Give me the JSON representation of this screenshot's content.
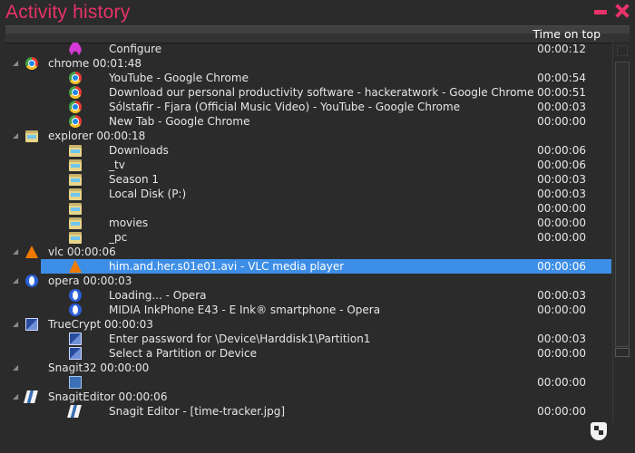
{
  "window": {
    "title": "Activity history"
  },
  "header": {
    "column_label": "Time on top"
  },
  "rows": [
    {
      "kind": "child",
      "icon": "configure",
      "label": "Configure",
      "time": "00:00:12"
    },
    {
      "kind": "group",
      "icon": "chrome",
      "label": "chrome   00:01:48"
    },
    {
      "kind": "child",
      "icon": "chrome",
      "label": "YouTube - Google Chrome",
      "time": "00:00:54"
    },
    {
      "kind": "child",
      "icon": "chrome",
      "label": "Download our personal productivity software - hackeratwork - Google Chrome",
      "time": "00:00:51"
    },
    {
      "kind": "child",
      "icon": "chrome",
      "label": "Sólstafir - Fjara (Official Music Video) - YouTube - Google Chrome",
      "time": "00:00:03"
    },
    {
      "kind": "child",
      "icon": "chrome",
      "label": "New Tab - Google Chrome",
      "time": "00:00:00"
    },
    {
      "kind": "group",
      "icon": "folder",
      "label": "explorer   00:00:18"
    },
    {
      "kind": "child",
      "icon": "folder",
      "label": "Downloads",
      "time": "00:00:06"
    },
    {
      "kind": "child",
      "icon": "folder",
      "label": "_tv",
      "time": "00:00:06"
    },
    {
      "kind": "child",
      "icon": "folder",
      "label": "Season 1",
      "time": "00:00:03"
    },
    {
      "kind": "child",
      "icon": "folder",
      "label": "Local Disk (P:)",
      "time": "00:00:03"
    },
    {
      "kind": "child",
      "icon": "folder",
      "label": "",
      "time": "00:00:00"
    },
    {
      "kind": "child",
      "icon": "folder",
      "label": "movies",
      "time": "00:00:00"
    },
    {
      "kind": "child",
      "icon": "folder",
      "label": "_pc",
      "time": "00:00:00"
    },
    {
      "kind": "group",
      "icon": "vlc",
      "label": "vlc   00:00:06"
    },
    {
      "kind": "child",
      "icon": "vlc",
      "label": "him.and.her.s01e01.avi - VLC media player",
      "time": "00:00:06",
      "selected": true
    },
    {
      "kind": "group",
      "icon": "opera",
      "label": "opera   00:00:03"
    },
    {
      "kind": "child",
      "icon": "opera",
      "label": "Loading... - Opera",
      "time": "00:00:03"
    },
    {
      "kind": "child",
      "icon": "opera",
      "label": "MIDIA InkPhone E43 - E Ink® smartphone - Opera",
      "time": "00:00:00"
    },
    {
      "kind": "group",
      "icon": "truecrypt",
      "label": "TrueCrypt   00:00:03"
    },
    {
      "kind": "child",
      "icon": "truecrypt",
      "label": "Enter password for \\Device\\Harddisk1\\Partition1",
      "time": "00:00:03"
    },
    {
      "kind": "child",
      "icon": "truecrypt",
      "label": "Select a Partition or Device",
      "time": "00:00:00"
    },
    {
      "kind": "group",
      "icon": "none",
      "label": "Snagit32   00:00:00"
    },
    {
      "kind": "child",
      "icon": "snagit",
      "label": "",
      "time": "00:00:00"
    },
    {
      "kind": "group",
      "icon": "snagiteditor",
      "label": "SnagitEditor   00:00:06"
    },
    {
      "kind": "child",
      "icon": "snagiteditor",
      "label": "Snagit Editor - [time-tracker.jpg]",
      "time": "00:00:00"
    }
  ],
  "colors": {
    "accent": "#e8326a",
    "selection": "#3d8ee6",
    "background": "#2b2b2b"
  }
}
